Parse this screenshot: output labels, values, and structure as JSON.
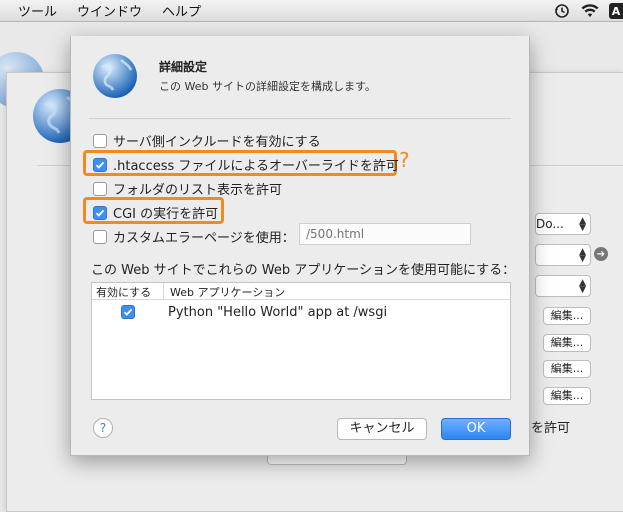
{
  "menubar": {
    "items": [
      "ツール",
      "ウインドウ",
      "ヘルプ"
    ],
    "icons": [
      "time-machine-icon",
      "wifi-icon"
    ],
    "user_letter": "A"
  },
  "background": {
    "select_1": "Do...",
    "select_2": "",
    "select_3": "",
    "edit_label": "編集...",
    "allow_label": "を許可"
  },
  "dialog": {
    "title": "詳細設定",
    "subtitle": "この Web サイトの詳細設定を構成します。",
    "options": [
      {
        "label": "サーバ側インクルードを有効にする",
        "checked": false
      },
      {
        "label": ".htaccess ファイルによるオーバーライドを許可",
        "checked": true
      },
      {
        "label": "フォルダのリスト表示を許可",
        "checked": false
      },
      {
        "label": "CGI の実行を許可",
        "checked": true
      },
      {
        "label": "カスタムエラーページを使用：",
        "checked": false
      }
    ],
    "error_page_placeholder": "/500.html",
    "question_mark": "?",
    "apps_label": "この Web サイトでこれらの Web アプリケーションを使用可能にする：",
    "table": {
      "col_enabled": "有効にする",
      "col_app": "Web アプリケーション",
      "rows": [
        {
          "enabled": true,
          "name": "Python \"Hello World\" app at /wsgi"
        }
      ]
    },
    "help_label": "?",
    "cancel_label": "キャンセル",
    "ok_label": "OK"
  },
  "colors": {
    "accent": "#3d8ef5",
    "highlight": "#f28a1d"
  }
}
